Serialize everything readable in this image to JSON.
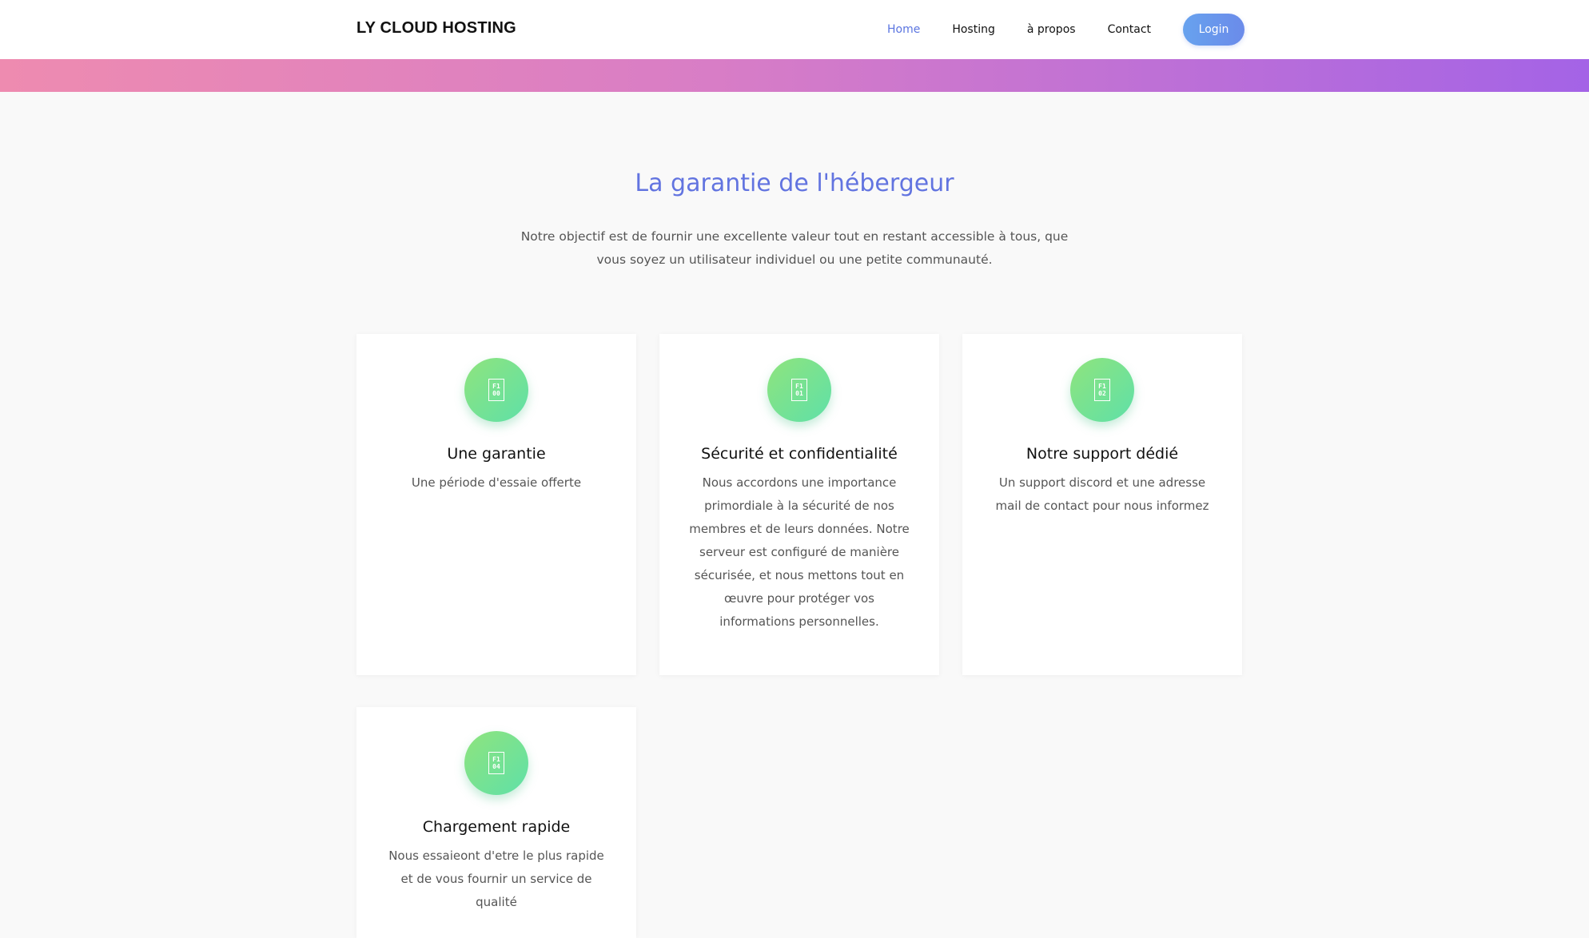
{
  "navbar": {
    "brand": "LY CLOUD HOSTING",
    "links": [
      {
        "label": "Home",
        "active": true
      },
      {
        "label": "Hosting",
        "active": false
      },
      {
        "label": "à propos",
        "active": false
      },
      {
        "label": "Contact",
        "active": false
      }
    ],
    "login_label": "Login"
  },
  "section": {
    "title": "La garantie de l'hébergeur",
    "subtitle": "Notre objectif est de fournir une excellente valeur tout en restant accessible à tous, que vous soyez un utilisateur individuel ou une petite communauté."
  },
  "cards": [
    {
      "icon_name": "feature-icon",
      "icon_top": "F1",
      "icon_bottom": "00",
      "title": "Une garantie",
      "text": "Une période d'essaie offerte"
    },
    {
      "icon_name": "feature-icon",
      "icon_top": "F1",
      "icon_bottom": "01",
      "title": "Sécurité et confidentialité",
      "text": "Nous accordons une importance primordiale à la sécurité de nos membres et de leurs données. Notre serveur est configuré de manière sécurisée, et nous mettons tout en œuvre pour protéger vos informations personnelles."
    },
    {
      "icon_name": "feature-icon",
      "icon_top": "F1",
      "icon_bottom": "02",
      "title": "Notre support dédié",
      "text": "Un support discord et une adresse mail de contact pour nous informez"
    },
    {
      "icon_name": "feature-icon",
      "icon_top": "F1",
      "icon_bottom": "04",
      "title": "Chargement rapide",
      "text": "Nous essaieont d'etre le plus rapide et de vous fournir un service de qualité"
    }
  ],
  "colors": {
    "accent": "#6274e0",
    "gradient_start": "#ee8bb0",
    "gradient_end": "#a463e6",
    "icon_green": "#6be0a0"
  }
}
